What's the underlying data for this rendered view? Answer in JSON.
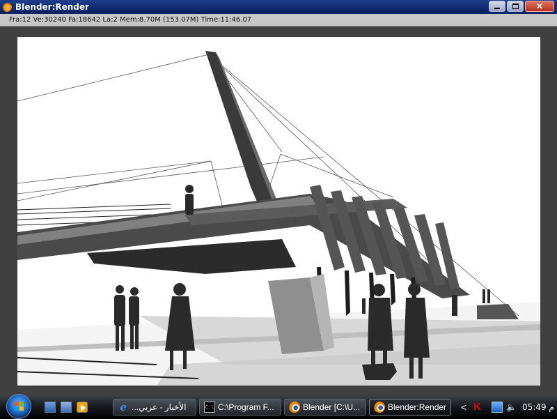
{
  "window": {
    "title": "Blender:Render",
    "icon": "blender-icon",
    "controls": {
      "minimize": "minimize-icon",
      "maximize": "restore-icon",
      "close": "✕"
    }
  },
  "infobar": {
    "text": "Fra:12  Ve:30240 Fa:18642 La:2 Mem:8.70M (153.07M) Time:11:46.07"
  },
  "render": {
    "description_icon": "render-image",
    "scene": "bridge-render"
  },
  "taskbar": {
    "start_icon": "windows-orb-icon",
    "quick_launch": [
      "show-desktop-icon",
      "switch-windows-icon",
      "media-player-icon"
    ],
    "tasks": [
      {
        "label": "...الأخبار - عربي",
        "icon": "ie-icon",
        "active": false
      },
      {
        "label": "C:\\Program F...",
        "icon": "cmd-icon",
        "active": false
      },
      {
        "label": "Blender [C:\\U...",
        "icon": "blender-icon",
        "active": false
      },
      {
        "label": "Blender:Render",
        "icon": "blender-icon",
        "active": true
      }
    ],
    "tray": {
      "chevron": "<",
      "clock": "05:49",
      "clock_suffix": "م"
    }
  },
  "colors": {
    "titlebar": "#0f2a6e",
    "infobar": "#c7c7c7",
    "workspace": "#404040",
    "render_bg": "#ffffff"
  }
}
